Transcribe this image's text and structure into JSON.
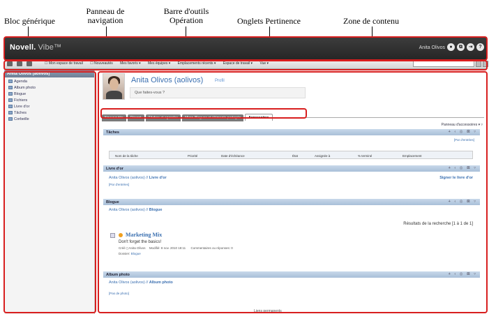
{
  "callouts": {
    "bloc": "Bloc générique",
    "panneau_line1": "Panneau de",
    "panneau_line2": "navigation",
    "barre_line1": "Barre d'outils",
    "barre_line2": "Opération",
    "onglets": "Onglets Pertinence",
    "zone": "Zone de contenu"
  },
  "header": {
    "logo": "Novell.",
    "logo_product": "Vibe™",
    "user": "Anita Olivos",
    "icons": [
      "user-icon",
      "share-icon",
      "logout-icon",
      "help-icon"
    ],
    "icon_glyphs": [
      "●",
      "⧉",
      "⇥",
      "?"
    ]
  },
  "toolbar": {
    "items": [
      "☐ Mon espace de travail",
      "☐ Nouveautés",
      "Mes favoris ▾",
      "Mes équipes ▾",
      "Emplacements récents ▾",
      "Espace de travail ▾",
      "Vue ▾"
    ]
  },
  "nav": {
    "title": "Anita Olivos (aolivos)",
    "items": [
      "Agenda",
      "Album photo",
      "Blogue",
      "Fichiers",
      "Livre d'or",
      "Tâches",
      "Corbeille"
    ]
  },
  "profile": {
    "name": "Anita Olivos (aolivos)",
    "link": "Profil",
    "status_placeholder": "Que faites-vous ?"
  },
  "tabs": [
    "Nouveautés",
    "Récent",
    "Tâches et agendas",
    "Micro-Blogues et éléments partagés",
    "Accessoires"
  ],
  "accessory_panel": "Panneau d'accessoires ▾ ▿",
  "sections": {
    "taches": {
      "title": "Tâches",
      "controls": "+ ‹ ◎ ⊠ ▿",
      "pager": "[Par d'entrées]",
      "columns": [
        "Nom de la tâche",
        "Priorité",
        "Date d'échéance",
        "État",
        "Assignée à",
        "% terminé",
        "Emplacement"
      ]
    },
    "livre": {
      "title": "Livre d'or",
      "controls": "+ ‹ ◎ ⊠ ▿",
      "path": "Anita Olivos (aolivos) //",
      "path_bold": "Livre d'or",
      "sign": "Signer le livre d'or",
      "pager": "[Par d'entrées]"
    },
    "blogue": {
      "title": "Blogue",
      "controls": "+ ‹ ◎ ⊠ ▿",
      "path": "Anita Olivos (aolivos) //",
      "path_bold": "Blogue",
      "results": "Résultats de la recherche [1 à 1 de 1]",
      "entry_title": "Marketing Mix",
      "entry_text": "Don't forget the basics!",
      "entry_meta_created": "Créé",
      "entry_meta_author": "Anita Olivos",
      "entry_meta_modified": "Modifié: 8 nov. 2010 18:11",
      "entry_meta_comments": "Commentaires ou réponses: 0",
      "entry_folder_label": "Dossier:",
      "entry_folder": "Blogue"
    },
    "album": {
      "title": "Album photo",
      "controls": "+ ‹ ◎ ⊠ ▿",
      "path": "Anita Olivos (aolivos) //",
      "path_bold": "Album photo",
      "pager": "[Pas de photo]"
    }
  },
  "footer": "Liens permanents",
  "colors": {
    "highlight": "#d81e1e",
    "header_bg": "#2e2e2e",
    "section_hdr": "#b8cce2",
    "link": "#3a6fb0"
  }
}
